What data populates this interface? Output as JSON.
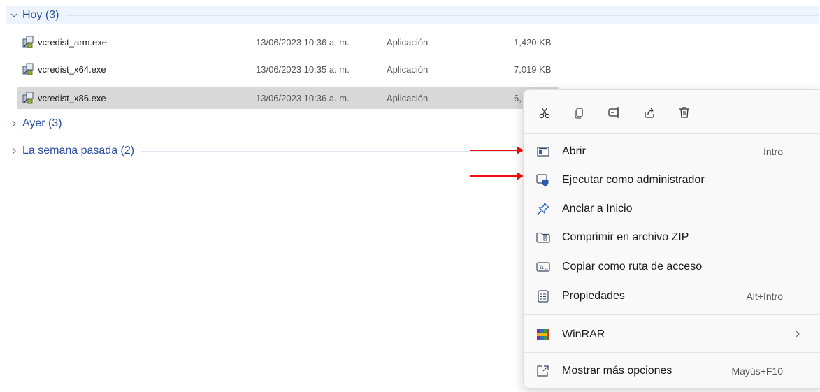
{
  "groups": {
    "today": {
      "label": "Hoy (3)"
    },
    "yesterday": {
      "label": "Ayer (3)"
    },
    "last_week": {
      "label": "La semana pasada (2)"
    }
  },
  "files": [
    {
      "name": "vcredist_arm.exe",
      "date": "13/06/2023 10:36 a. m.",
      "type": "Aplicación",
      "size": "1,420 KB",
      "selected": false
    },
    {
      "name": "vcredist_x64.exe",
      "date": "13/06/2023 10:35 a. m.",
      "type": "Aplicación",
      "size": "7,019 KB",
      "selected": false
    },
    {
      "name": "vcredist_x86.exe",
      "date": "13/06/2023 10:36 a. m.",
      "type": "Aplicación",
      "size": "6,",
      "selected": true
    }
  ],
  "context_menu": {
    "quick_actions": [
      "cut-icon",
      "copy-icon",
      "rename-icon",
      "share-icon",
      "delete-icon"
    ],
    "items": [
      {
        "label": "Abrir",
        "shortcut": "Intro",
        "icon": "open-window-icon"
      },
      {
        "label": "Ejecutar como administrador",
        "shortcut": "",
        "icon": "run-as-admin-icon"
      },
      {
        "label": "Anclar a Inicio",
        "shortcut": "",
        "icon": "pin-icon"
      },
      {
        "label": "Comprimir en archivo ZIP",
        "shortcut": "",
        "icon": "zip-folder-icon"
      },
      {
        "label": "Copiar como ruta de acceso",
        "shortcut": "",
        "icon": "copy-path-icon"
      },
      {
        "label": "Propiedades",
        "shortcut": "Alt+Intro",
        "icon": "properties-icon"
      },
      {
        "label": "WinRAR",
        "shortcut": "",
        "icon": "winrar-icon",
        "submenu": true
      },
      {
        "label": "Mostrar más opciones",
        "shortcut": "Mayús+F10",
        "icon": "more-options-icon"
      }
    ]
  },
  "colors": {
    "accent": "#2a4ea2",
    "annotation_arrow": "#e11111",
    "selection": "#d8d8d8"
  }
}
